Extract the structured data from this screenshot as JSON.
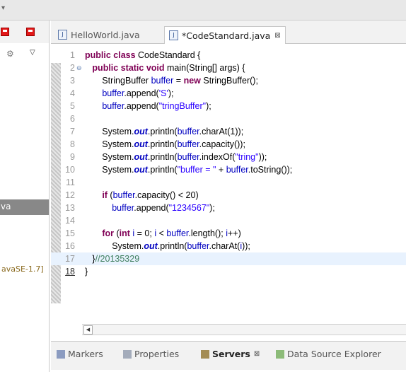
{
  "editor_tabs": [
    {
      "label": "HelloWorld.java"
    },
    {
      "label": "*CodeStandard.java",
      "close": "⊠"
    }
  ],
  "left_pane": {
    "selected_fragment": "va",
    "jre_fragment": "avaSE-1.7]"
  },
  "code_lines": [
    {
      "n": "1",
      "segs": [
        [
          "kw",
          "public class "
        ],
        [
          "",
          "CodeStandard {"
        ]
      ]
    },
    {
      "n": "2",
      "fold": "⊖",
      "segs": [
        [
          "",
          "   "
        ],
        [
          "kw",
          "public static void "
        ],
        [
          "",
          "main(String[] args) {"
        ]
      ]
    },
    {
      "n": "3",
      "segs": [
        [
          "",
          "       StringBuffer "
        ],
        [
          "fld",
          "buffer"
        ],
        [
          "",
          " = "
        ],
        [
          "kw",
          "new "
        ],
        [
          "",
          "StringBuffer();"
        ]
      ]
    },
    {
      "n": "4",
      "segs": [
        [
          "",
          "       "
        ],
        [
          "fld",
          "buffer"
        ],
        [
          "",
          ".append("
        ],
        [
          "str",
          "'S'"
        ],
        [
          "",
          ");"
        ]
      ]
    },
    {
      "n": "5",
      "segs": [
        [
          "",
          "       "
        ],
        [
          "fld",
          "buffer"
        ],
        [
          "",
          ".append("
        ],
        [
          "str",
          "\"tringBuffer\""
        ],
        [
          "",
          ");"
        ]
      ]
    },
    {
      "n": "6",
      "segs": []
    },
    {
      "n": "7",
      "segs": [
        [
          "",
          "       System."
        ],
        [
          "stat",
          "out"
        ],
        [
          "",
          ".println("
        ],
        [
          "fld",
          "buffer"
        ],
        [
          "",
          ".charAt(1));"
        ]
      ]
    },
    {
      "n": "8",
      "segs": [
        [
          "",
          "       System."
        ],
        [
          "stat",
          "out"
        ],
        [
          "",
          ".println("
        ],
        [
          "fld",
          "buffer"
        ],
        [
          "",
          ".capacity());"
        ]
      ]
    },
    {
      "n": "9",
      "segs": [
        [
          "",
          "       System."
        ],
        [
          "stat",
          "out"
        ],
        [
          "",
          ".println("
        ],
        [
          "fld",
          "buffer"
        ],
        [
          "",
          ".indexOf("
        ],
        [
          "str",
          "\"tring\""
        ],
        [
          "",
          "));"
        ]
      ]
    },
    {
      "n": "10",
      "segs": [
        [
          "",
          "       System."
        ],
        [
          "stat",
          "out"
        ],
        [
          "",
          ".println("
        ],
        [
          "str",
          "\"buffer = \""
        ],
        [
          "",
          " + "
        ],
        [
          "fld",
          "buffer"
        ],
        [
          "",
          ".toString());"
        ]
      ]
    },
    {
      "n": "11",
      "segs": []
    },
    {
      "n": "12",
      "segs": [
        [
          "",
          "       "
        ],
        [
          "kw",
          "if "
        ],
        [
          "",
          "("
        ],
        [
          "fld",
          "buffer"
        ],
        [
          "",
          ".capacity() < 20)"
        ]
      ]
    },
    {
      "n": "13",
      "segs": [
        [
          "",
          "           "
        ],
        [
          "fld",
          "buffer"
        ],
        [
          "",
          ".append("
        ],
        [
          "str",
          "\"1234567\""
        ],
        [
          "",
          ");"
        ]
      ]
    },
    {
      "n": "14",
      "segs": []
    },
    {
      "n": "15",
      "segs": [
        [
          "",
          "       "
        ],
        [
          "kw",
          "for "
        ],
        [
          "",
          "("
        ],
        [
          "kw",
          "int "
        ],
        [
          "fld",
          "i"
        ],
        [
          "",
          " = 0; "
        ],
        [
          "fld",
          "i"
        ],
        [
          "",
          " < "
        ],
        [
          "fld",
          "buffer"
        ],
        [
          "",
          ".length(); "
        ],
        [
          "fld",
          "i"
        ],
        [
          "",
          "++)"
        ]
      ]
    },
    {
      "n": "16",
      "segs": [
        [
          "",
          "           System."
        ],
        [
          "stat",
          "out"
        ],
        [
          "",
          ".println("
        ],
        [
          "fld",
          "buffer"
        ],
        [
          "",
          ".charAt("
        ],
        [
          "fld",
          "i"
        ],
        [
          "",
          "));"
        ]
      ]
    },
    {
      "n": "17",
      "current": true,
      "segs": [
        [
          "",
          "   }"
        ],
        [
          "cmt",
          "//20135329"
        ]
      ]
    },
    {
      "n": "18",
      "bold": true,
      "segs": [
        [
          "",
          "}"
        ]
      ]
    }
  ],
  "bottom_tabs": [
    {
      "label": "Markers",
      "icon": "markers-icon",
      "color": "#6a7fb0"
    },
    {
      "label": "Properties",
      "icon": "properties-icon",
      "color": "#8a94a8"
    },
    {
      "label": "Servers",
      "icon": "servers-icon",
      "color": "#8a6a1e",
      "active": true,
      "close": "⊠"
    },
    {
      "label": "Data Source Explorer",
      "icon": "data-source-icon",
      "color": "#6aa84f"
    }
  ]
}
